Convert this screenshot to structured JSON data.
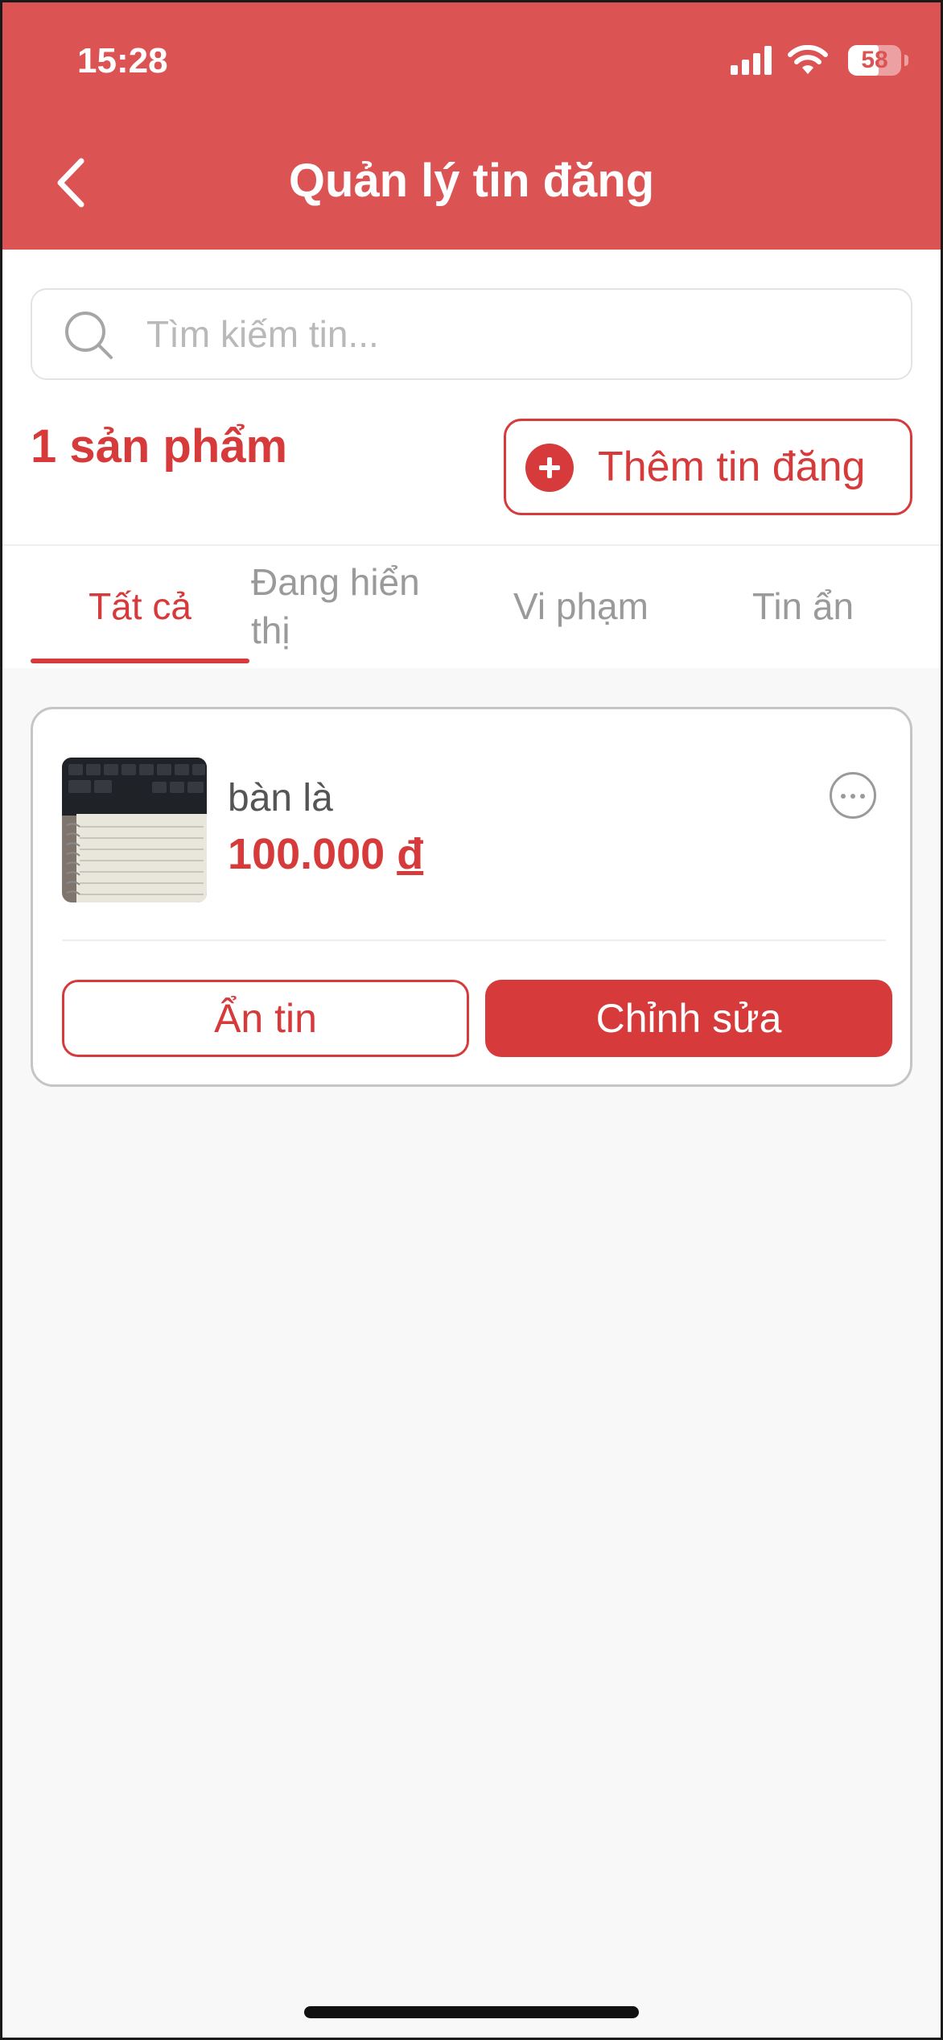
{
  "status_bar": {
    "time": "15:28",
    "battery_level": "58",
    "icons": [
      "cellular-signal-icon",
      "wifi-icon",
      "battery-icon"
    ]
  },
  "header": {
    "title": "Quản lý tin đăng",
    "back_icon": "chevron-left-icon"
  },
  "search": {
    "placeholder": "Tìm kiếm tin...",
    "icon": "search-icon"
  },
  "summary": {
    "count_label": "1 sản phẩm",
    "add_button_label": "Thêm tin đăng",
    "add_icon": "plus-circle-icon"
  },
  "tabs": [
    {
      "label": "Tất cả",
      "active": true
    },
    {
      "label": "Đang hiển thị",
      "active": false
    },
    {
      "label": "Vi phạm",
      "active": false
    },
    {
      "label": "Tin ẩn",
      "active": false
    }
  ],
  "listings": [
    {
      "name": "bàn là",
      "price": "100.000",
      "currency": "đ",
      "more_icon": "more-horizontal-icon",
      "hide_label": "Ẩn tin",
      "edit_label": "Chỉnh sửa"
    }
  ],
  "colors": {
    "header_bg": "#dc5354",
    "accent": "#d63a3a",
    "inactive_tab": "#9a9a9a",
    "page_bg": "#f8f8f8"
  }
}
